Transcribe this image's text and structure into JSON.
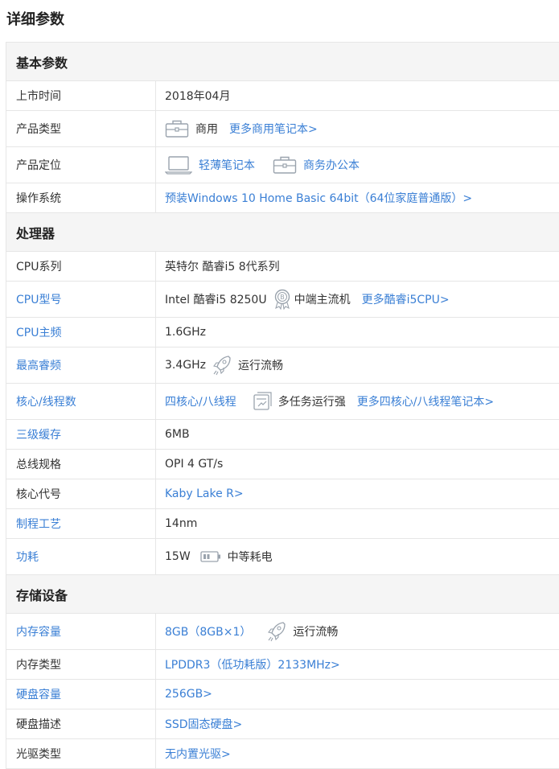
{
  "page_title": "详细参数",
  "sections": {
    "basic": {
      "title": "基本参数",
      "launch_time_label": "上市时间",
      "launch_time_value": "2018年04月",
      "product_type_label": "产品类型",
      "product_type_value": "商用",
      "product_type_link": "更多商用笔记本>",
      "positioning_label": "产品定位",
      "positioning_value_1": "轻薄笔记本",
      "positioning_value_2": "商务办公本",
      "os_label": "操作系统",
      "os_value": "预装Windows 10 Home Basic 64bit（64位家庭普通版）>"
    },
    "processor": {
      "title": "处理器",
      "cpu_series_label": "CPU系列",
      "cpu_series_value": "英特尔 酷睿i5 8代系列",
      "cpu_model_label": "CPU型号",
      "cpu_model_value": "Intel 酷睿i5 8250U",
      "cpu_model_badge": "中端主流机",
      "cpu_model_link": "更多酷睿i5CPU>",
      "cpu_freq_label": "CPU主频",
      "cpu_freq_value": "1.6GHz",
      "turbo_label": "最高睿频",
      "turbo_value": "3.4GHz",
      "turbo_badge": "运行流畅",
      "cores_label": "核心/线程数",
      "cores_value": "四核心/八线程",
      "cores_badge": "多任务运行强",
      "cores_link": "更多四核心/八线程笔记本>",
      "l3_label": "三级缓存",
      "l3_value": "6MB",
      "bus_label": "总线规格",
      "bus_value": "OPI 4 GT/s",
      "codename_label": "核心代号",
      "codename_value": "Kaby Lake R>",
      "process_label": "制程工艺",
      "process_value": "14nm",
      "power_label": "功耗",
      "power_value": "15W",
      "power_badge": "中等耗电"
    },
    "storage": {
      "title": "存储设备",
      "ram_size_label": "内存容量",
      "ram_size_value": "8GB（8GB×1）",
      "ram_size_badge": "运行流畅",
      "ram_type_label": "内存类型",
      "ram_type_value": "LPDDR3（低功耗版）2133MHz>",
      "disk_size_label": "硬盘容量",
      "disk_size_value": "256GB>",
      "disk_desc_label": "硬盘描述",
      "disk_desc_value": "SSD固态硬盘>",
      "optical_label": "光驱类型",
      "optical_value": "无内置光驱>"
    }
  },
  "icons": {
    "briefcase": "briefcase-icon",
    "laptop": "laptop-icon",
    "badge": "medal-icon",
    "rocket": "rocket-icon",
    "multitask": "multitask-icon",
    "battery": "battery-icon"
  },
  "colors": {
    "link": "#3a7fd5",
    "border": "#e6e6e6",
    "section_bg": "#f5f5f5",
    "icon_gray": "#9aa3ad"
  }
}
